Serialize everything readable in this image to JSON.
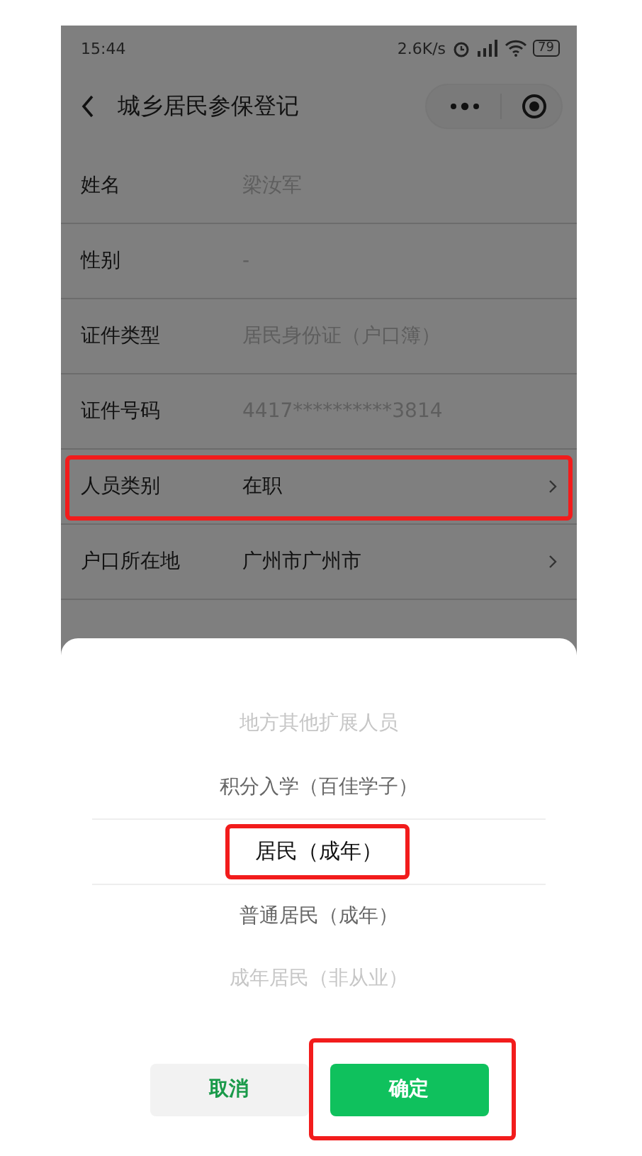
{
  "status_bar": {
    "time": "15:44",
    "speed": "2.6K/s",
    "battery": "79"
  },
  "nav": {
    "title": "城乡居民参保登记"
  },
  "rows": [
    {
      "label": "姓名",
      "value": "梁汝军",
      "kind": "text",
      "highlighted": false
    },
    {
      "label": "性别",
      "value": "-",
      "kind": "text",
      "highlighted": false
    },
    {
      "label": "证件类型",
      "value": "居民身份证（户口簿）",
      "kind": "text",
      "highlighted": false
    },
    {
      "label": "证件号码",
      "value": "4417**********3814",
      "kind": "text",
      "highlighted": false
    },
    {
      "label": "人员类别",
      "value": "在职",
      "kind": "select",
      "highlighted": true
    },
    {
      "label": "户口所在地",
      "value": "广州市广州市",
      "kind": "select",
      "highlighted": false
    }
  ],
  "picker": {
    "options": [
      {
        "label": "地方其他扩展人员",
        "selected": false,
        "highlighted": false
      },
      {
        "label": "积分入学（百佳学子）",
        "selected": false,
        "highlighted": false
      },
      {
        "label": "居民（成年）",
        "selected": true,
        "highlighted": true
      },
      {
        "label": "普通居民（成年）",
        "selected": false,
        "highlighted": false
      },
      {
        "label": "成年居民（非从业）",
        "selected": false,
        "highlighted": false
      }
    ]
  },
  "buttons": [
    {
      "label": "取消",
      "kind": "cancel",
      "highlighted": false
    },
    {
      "label": "确定",
      "kind": "confirm",
      "highlighted": true
    }
  ]
}
